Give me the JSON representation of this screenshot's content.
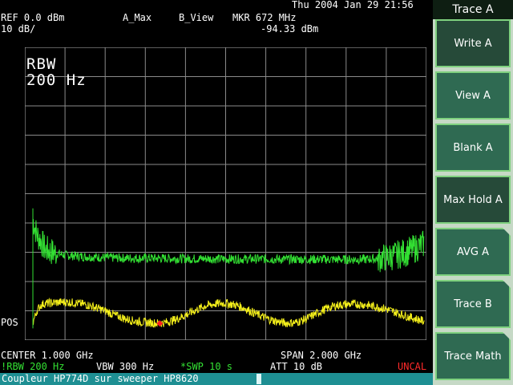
{
  "header": {
    "datetime": "Thu 2004 Jan 29 21:56",
    "ref_level": "REF 0.0 dBm",
    "scale": "10 dB/",
    "trace_a_mode": "A_Max",
    "trace_b_mode": "B_View",
    "marker_freq": "MKR 672 MHz",
    "marker_level": "-94.33 dBm"
  },
  "overlay": {
    "rbw_label": "RBW",
    "rbw_value": "200 Hz"
  },
  "side_label": "POS",
  "footer": {
    "center": "CENTER 1.000 GHz",
    "span": "SPAN 2.000 GHz",
    "rbw": "!RBW 200 Hz",
    "vbw": "VBW 300 Hz",
    "sweep": "*SWP 10 s",
    "att": "ATT 10 dB",
    "uncal": "UNCAL"
  },
  "bottom_bar": {
    "text": "Coupleur HP774D sur sweeper HP8620"
  },
  "softkeys": {
    "title": "Trace A",
    "items": [
      {
        "label": "Write A"
      },
      {
        "label": "View A"
      },
      {
        "label": "Blank A"
      },
      {
        "label": "Max Hold A"
      },
      {
        "label": "AVG A"
      },
      {
        "label": "Trace B"
      },
      {
        "label": "Trace Math"
      }
    ]
  },
  "colors": {
    "trace_green": "#33e033",
    "trace_yellow": "#f4ef1a",
    "marker": "#ff2020",
    "uncal": "#ff2a2a",
    "softkey_fill": "#2f6a52",
    "softkey_border": "#7fd17f",
    "bottom_bar": "#1e8f93"
  },
  "chart_data": {
    "type": "line",
    "xlim": [
      0,
      2000
    ],
    "ylim": [
      -100,
      0
    ],
    "grid": true,
    "series": [
      {
        "x": [
          40,
          60,
          80,
          100,
          140,
          200,
          300,
          400,
          500,
          600,
          700,
          800,
          900,
          1000,
          1100,
          1200,
          1300,
          1400,
          1500,
          1600,
          1700,
          1750,
          1800,
          1850,
          1900,
          1950,
          1990
        ],
        "values": [
          -59,
          -64,
          -66,
          -69,
          -70,
          -71,
          -71.5,
          -71.8,
          -72,
          -72,
          -72.1,
          -72.2,
          -72.2,
          -72.3,
          -72.3,
          -72.3,
          -72.4,
          -72.4,
          -72.4,
          -72.5,
          -72.4,
          -72.2,
          -71.8,
          -71,
          -70,
          -68.5,
          -67
        ]
      },
      {
        "x": [
          40,
          60,
          80,
          100,
          150,
          200,
          250,
          300,
          350,
          400,
          450,
          500,
          550,
          600,
          650,
          672,
          700,
          750,
          800,
          850,
          900,
          950,
          1000,
          1050,
          1100,
          1150,
          1200,
          1250,
          1300,
          1350,
          1400,
          1450,
          1500,
          1550,
          1600,
          1650,
          1700,
          1750,
          1800,
          1850,
          1900,
          1950,
          1990
        ],
        "values": [
          -94,
          -90,
          -88,
          -87.5,
          -87.2,
          -87,
          -87.3,
          -87.8,
          -88.8,
          -90,
          -91.5,
          -92.7,
          -93.6,
          -94,
          -94.2,
          -94.3,
          -94,
          -93,
          -91.5,
          -89.8,
          -88.3,
          -87.6,
          -87.4,
          -88,
          -89.3,
          -91,
          -92.5,
          -93.6,
          -94.2,
          -94,
          -92.8,
          -91,
          -89.3,
          -88.2,
          -87.8,
          -87.7,
          -88,
          -88.6,
          -89.4,
          -90.6,
          -91.8,
          -92.8,
          -93.6
        ]
      }
    ],
    "marker": {
      "x": 672,
      "y": -94.33
    }
  }
}
